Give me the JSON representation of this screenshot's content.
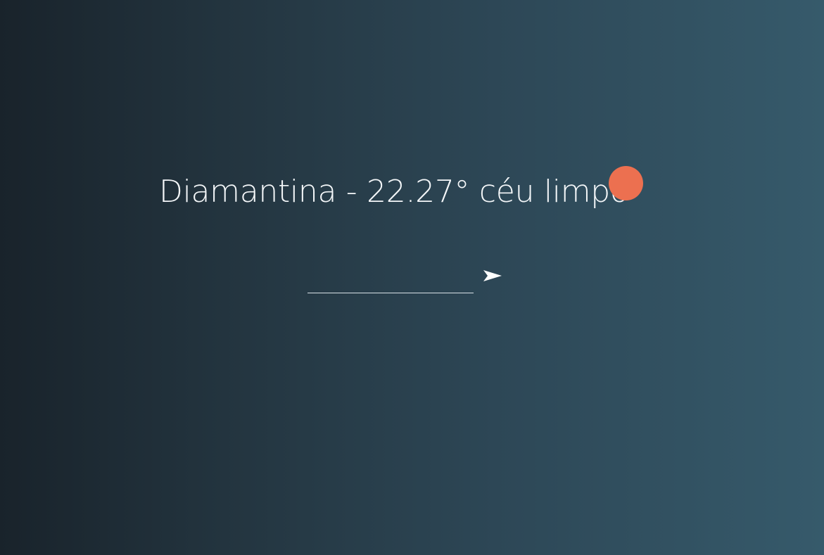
{
  "weather": {
    "display_text": "Diamantina - 22.27° céu limpo",
    "icon": "sun-icon",
    "icon_color": "#ec7050"
  },
  "search": {
    "value": "",
    "placeholder": "",
    "submit_icon": "send-arrow-icon"
  },
  "colors": {
    "background_start": "#19232b",
    "background_end": "#365a6b",
    "text": "#ffffff"
  }
}
